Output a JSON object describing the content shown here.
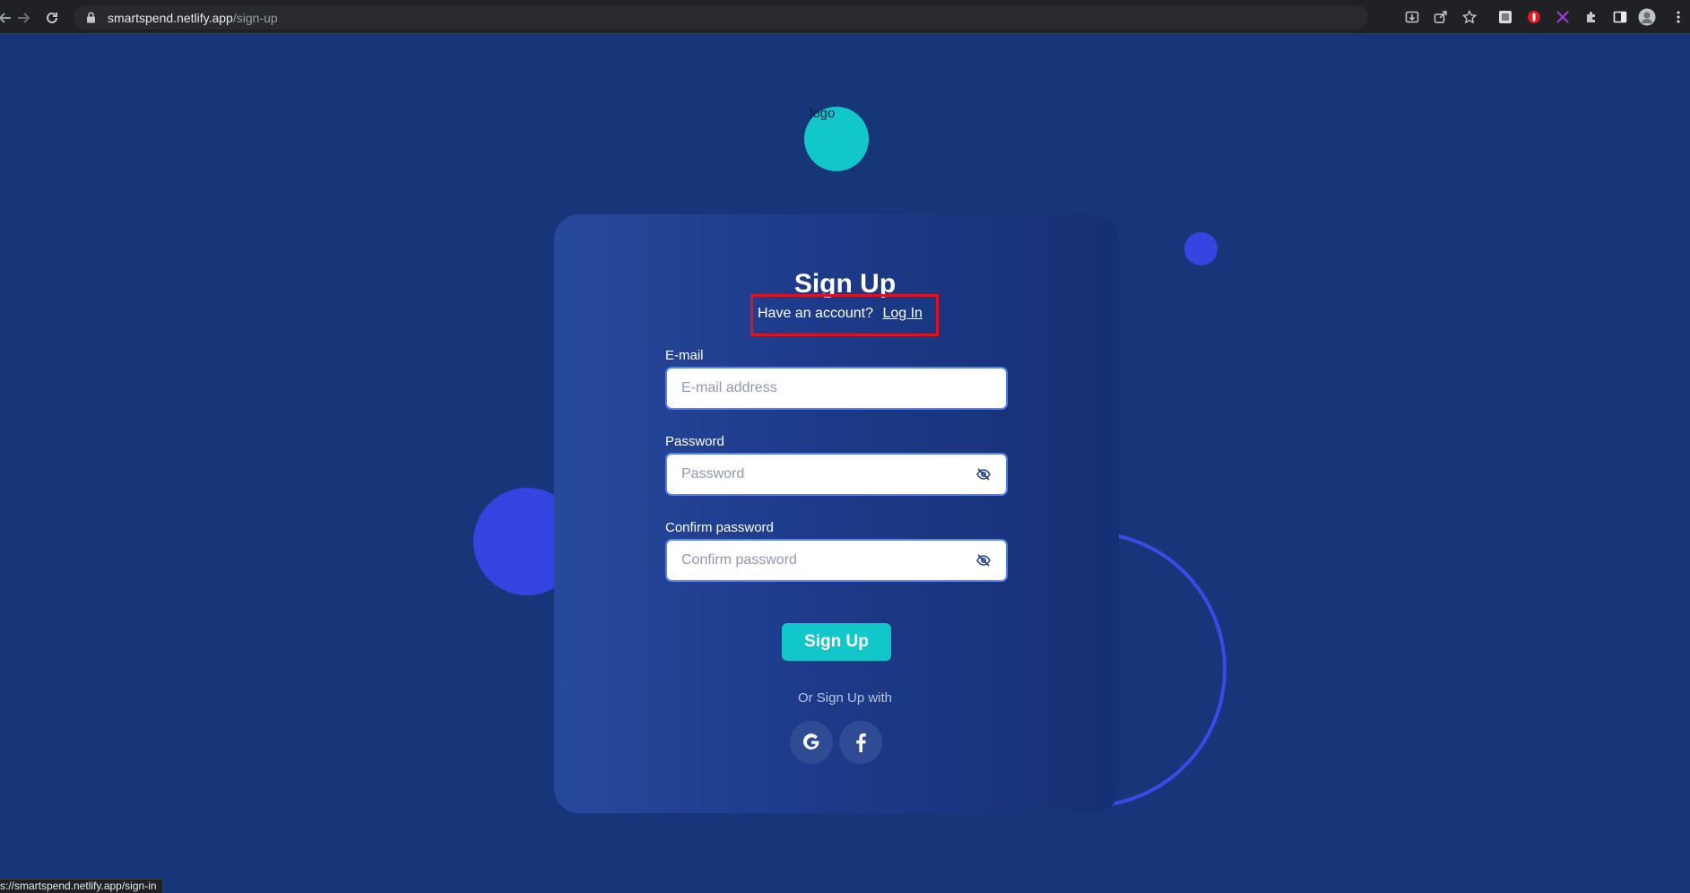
{
  "browser": {
    "url_host": "smartspend.netlify.app",
    "url_path": "/sign-up",
    "status_url": "s://smartspend.netlify.app/sign-in",
    "icons": [
      "back-icon",
      "forward-icon",
      "reload-icon",
      "lock-icon",
      "install-icon",
      "share-icon",
      "star-icon",
      "extension-icon",
      "puzzle-icon",
      "side-panel-icon",
      "profile-avatar",
      "menu-icon"
    ]
  },
  "logo": {
    "text": "logo"
  },
  "form": {
    "title": "Sign Up",
    "account_prompt": "Have an account?",
    "login_link": "Log In",
    "email": {
      "label": "E-mail",
      "placeholder": "E-mail address",
      "value": ""
    },
    "password": {
      "label": "Password",
      "placeholder": "Password",
      "value": ""
    },
    "confirm": {
      "label": "Confirm password",
      "placeholder": "Confirm password",
      "value": ""
    },
    "submit_label": "Sign Up",
    "or_text": "Or Sign Up with",
    "social": [
      {
        "name": "google",
        "glyph": "G"
      },
      {
        "name": "facebook",
        "glyph": "f"
      }
    ]
  },
  "colors": {
    "page_bg": "#17367a",
    "accent": "#12c7c9",
    "deco_blue": "#3545e2",
    "highlight": "#e0121f"
  }
}
